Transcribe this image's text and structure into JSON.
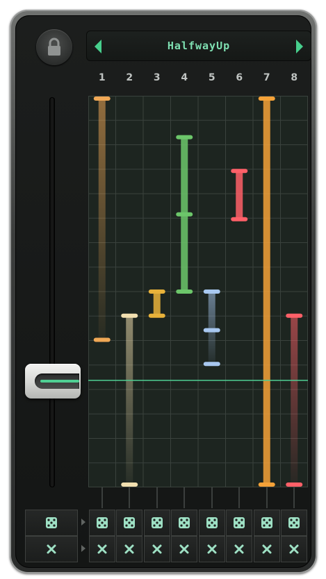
{
  "preset": {
    "name": "HalfwayUp",
    "prev_icon": "triangle-left-icon",
    "next_icon": "triangle-right-icon"
  },
  "lock_icon": "padlock-icon",
  "columns": [
    {
      "label": "1",
      "color": "#f0a856",
      "range": [
        1.0,
        0.375
      ],
      "mid": null,
      "filled": false
    },
    {
      "label": "2",
      "color": "#f2e0b0",
      "range": [
        0.4375,
        0.0
      ],
      "mid": null,
      "filled": false
    },
    {
      "label": "3",
      "color": "#e8b23a",
      "range": [
        0.5,
        0.4375
      ],
      "mid": null,
      "filled": true
    },
    {
      "label": "4",
      "color": "#6cc66a",
      "range": [
        0.9,
        0.5
      ],
      "mid": 0.7,
      "filled": true
    },
    {
      "label": "5",
      "color": "#a8c8f0",
      "range": [
        0.5,
        0.3125
      ],
      "mid": 0.4,
      "filled": false
    },
    {
      "label": "6",
      "color": "#ff6068",
      "range": [
        0.8125,
        0.6875
      ],
      "mid": null,
      "filled": true
    },
    {
      "label": "7",
      "color": "#f5a238",
      "range": [
        1.0,
        0.0
      ],
      "mid": null,
      "filled": true
    },
    {
      "label": "8",
      "color": "#ff6068",
      "range": [
        0.4375,
        0.0
      ],
      "mid": null,
      "filled": false
    }
  ],
  "master_slider": {
    "value": 0.27,
    "accent": "#4fcf93"
  },
  "row_icons": {
    "randomize": "dice-icon",
    "clear": "x-icon"
  },
  "colors": {
    "accent": "#7fe0b2",
    "grid_bg": "#1d2520",
    "grid_line": "#3a423d"
  }
}
